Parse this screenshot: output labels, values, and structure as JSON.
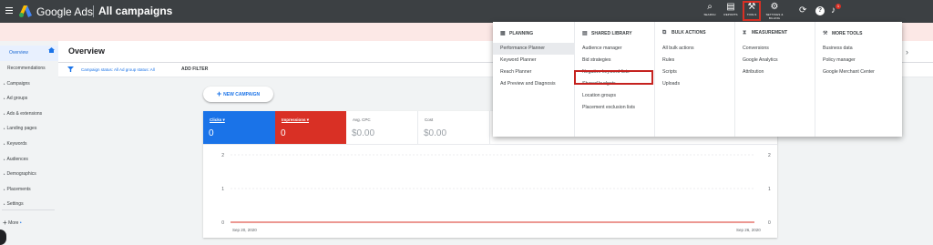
{
  "header": {
    "brand": "Google Ads",
    "page_title": "All campaigns",
    "tools": [
      {
        "label": "SEARCH",
        "icon": "search-icon",
        "glyph": "⌕"
      },
      {
        "label": "REPORTS",
        "icon": "reports-icon",
        "glyph": "▤"
      },
      {
        "label": "TOOLS",
        "icon": "wrench-icon",
        "glyph": "⚒"
      },
      {
        "label": "SETTINGS & BILLING",
        "icon": "gear-icon",
        "glyph": "⚙"
      }
    ],
    "refresh_glyph": "⟳",
    "help_glyph": "?",
    "bell_glyph": "♪",
    "notification_count": "1"
  },
  "sidebar": {
    "items": [
      {
        "label": "Overview",
        "active": true
      },
      {
        "label": "Recommendations"
      },
      {
        "label": "Campaigns",
        "child": true
      },
      {
        "label": "Ad groups",
        "child": true
      },
      {
        "label": "Ads & extensions",
        "child": true
      },
      {
        "label": "Landing pages",
        "child": true
      },
      {
        "label": "Keywords",
        "child": true
      },
      {
        "label": "Audiences",
        "child": true
      },
      {
        "label": "Demographics",
        "child": true
      },
      {
        "label": "Placements",
        "child": true
      },
      {
        "label": "Settings",
        "child": true
      }
    ],
    "more_label": "More"
  },
  "overview": {
    "title": "Overview",
    "filter_text": "Campaign status: All  Ad group status: All",
    "add_filter": "ADD FILTER",
    "new_campaign": "NEW CAMPAIGN"
  },
  "metrics": [
    {
      "label": "Clicks ▾",
      "value": "0"
    },
    {
      "label": "Impressions ▾",
      "value": "0"
    },
    {
      "label": "Avg. CPC",
      "value": "$0.00"
    },
    {
      "label": "Cost",
      "value": "$0.00"
    }
  ],
  "chart_data": {
    "type": "line",
    "x": [
      "Sep 20, 2020",
      "Sep 26, 2020"
    ],
    "series": [
      {
        "values": [
          0,
          0
        ],
        "color": "#d93025"
      }
    ],
    "y_ticks_left": [
      "2",
      "1",
      "0"
    ],
    "y_ticks_right": [
      "2",
      "1",
      "0"
    ],
    "ylim": [
      0,
      2
    ]
  },
  "dropdown": {
    "columns": [
      {
        "head": "PLANNING",
        "icon": "planning-icon",
        "glyph": "▦",
        "items": [
          "Performance Planner",
          "Keyword Planner",
          "Reach Planner",
          "Ad Preview and Diagnosis"
        ],
        "highlight": 0
      },
      {
        "head": "SHARED LIBRARY",
        "icon": "library-icon",
        "glyph": "▤",
        "items": [
          "Audience manager",
          "Bid strategies",
          "Negative keyword lists",
          "Shared budgets",
          "Location groups",
          "Placement exclusion lists"
        ],
        "highlight": -1
      },
      {
        "head": "BULK ACTIONS",
        "icon": "bulk-actions-icon",
        "glyph": "⧉",
        "items": [
          "All bulk actions",
          "Rules",
          "Scripts",
          "Uploads"
        ],
        "highlight": -1
      },
      {
        "head": "MEASUREMENT",
        "icon": "hourglass-icon",
        "glyph": "⧗",
        "items": [
          "Conversions",
          "Google Analytics",
          "Attribution"
        ],
        "highlight": -1
      },
      {
        "head": "MORE TOOLS",
        "icon": "wrench-icon",
        "glyph": "⚒",
        "items": [
          "Business data",
          "Policy manager",
          "Google Merchant Center"
        ],
        "highlight": -1
      }
    ]
  }
}
